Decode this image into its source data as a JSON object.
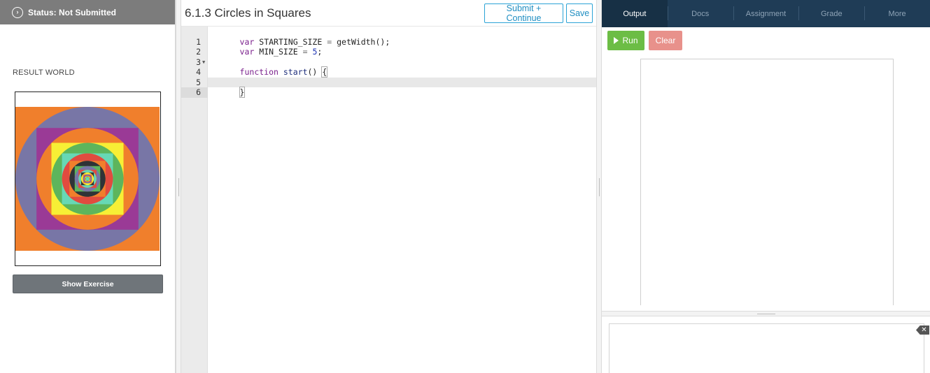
{
  "status": {
    "text": "Status: Not Submitted",
    "icon": "chevron-circle-icon"
  },
  "result_world": {
    "label": "RESULT WORLD"
  },
  "show_exercise": "Show Exercise",
  "exercise": {
    "title": "6.1.3 Circles in Squares"
  },
  "buttons": {
    "submit": "Submit + Continue",
    "save": "Save",
    "run": "Run",
    "clear": "Clear"
  },
  "tabs": [
    "Output",
    "Docs",
    "Assignment",
    "Grade",
    "More"
  ],
  "active_tab": "Output",
  "code": {
    "line_numbers": [
      "1",
      "2",
      "3",
      "4",
      "5",
      "6"
    ],
    "active_line": 6,
    "line1": {
      "kw": "var",
      "name": "STARTING_SIZE",
      "op": "=",
      "call": "getWidth();"
    },
    "line2": {
      "kw": "var",
      "name": "MIN_SIZE",
      "op": "=",
      "num": "5",
      "end": ";"
    },
    "line4": {
      "kw": "function",
      "fn": "start",
      "rest": "() ",
      "brace": "{"
    },
    "line6": {
      "brace": "}"
    }
  },
  "colors": {
    "orange": "#f07f2c",
    "slate": "#7876a6",
    "purple": "#9a3a96",
    "yellow": "#f7ef35",
    "green": "#5db55c",
    "red": "#e14b3f",
    "teal": "#67d8b5",
    "dark": "#2f3337",
    "run_green": "#6cbd45",
    "clear_red": "#e8918b",
    "tab_bar": "#1f3c56"
  }
}
